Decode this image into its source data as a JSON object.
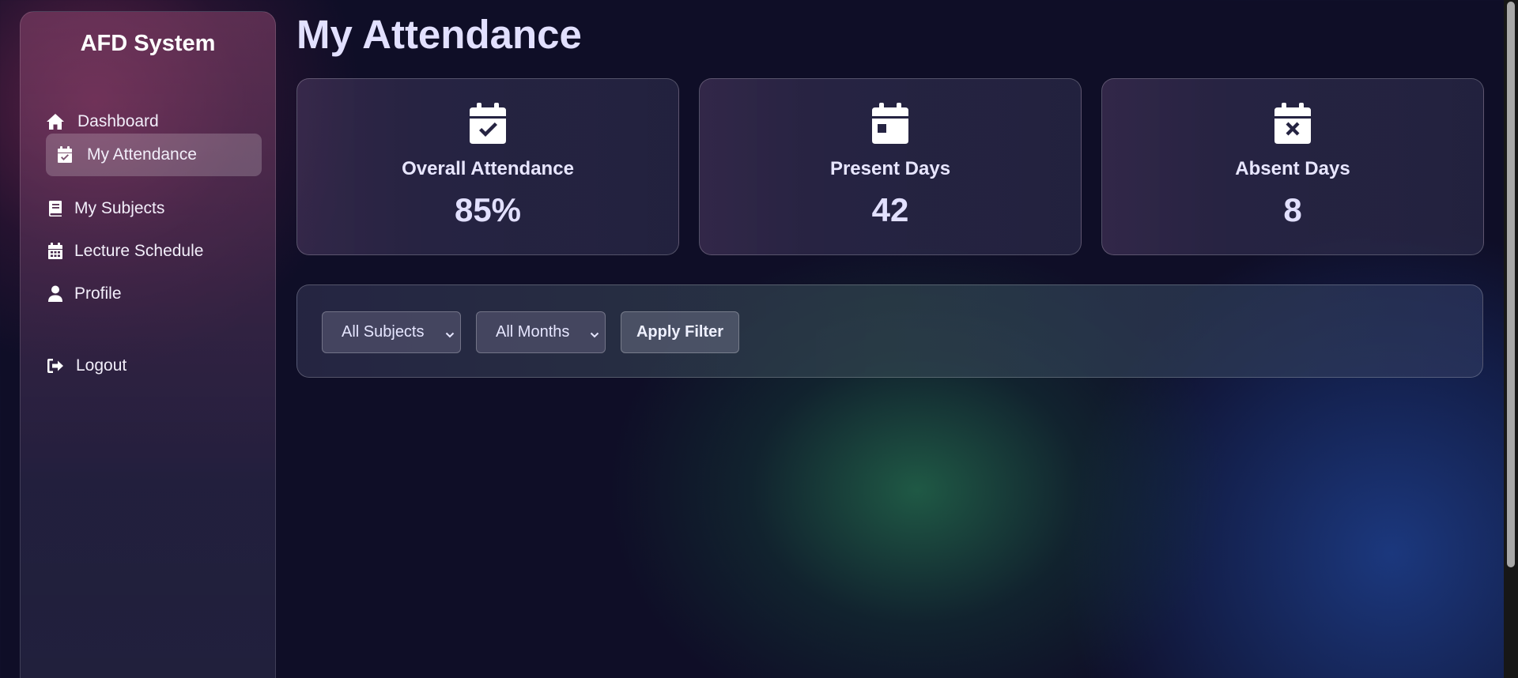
{
  "sidebar": {
    "brand": "AFD System",
    "items": [
      {
        "label": "Dashboard",
        "icon": "home-icon",
        "active": false
      },
      {
        "label": "My Attendance",
        "icon": "calendar-check-icon",
        "active": true
      },
      {
        "label": "My Subjects",
        "icon": "book-icon",
        "active": false
      },
      {
        "label": "Lecture Schedule",
        "icon": "calendar-grid-icon",
        "active": false
      },
      {
        "label": "Profile",
        "icon": "user-icon",
        "active": false
      }
    ],
    "logout": {
      "label": "Logout",
      "icon": "sign-out-icon"
    }
  },
  "main": {
    "title": "My Attendance",
    "cards": [
      {
        "label": "Overall Attendance",
        "value": "85%",
        "icon": "calendar-check-icon"
      },
      {
        "label": "Present Days",
        "value": "42",
        "icon": "calendar-day-icon"
      },
      {
        "label": "Absent Days",
        "value": "8",
        "icon": "calendar-x-icon"
      }
    ],
    "filters": {
      "subject_select": {
        "selected": "All Subjects"
      },
      "month_select": {
        "selected": "All Months"
      },
      "apply_label": "Apply Filter"
    }
  },
  "colors": {
    "background": "#0f0e27",
    "text": "#e6e6ff",
    "accent_green_glow": "#22664a",
    "accent_blue_glow": "#1c3a82",
    "accent_magenta_glow": "#782850"
  }
}
